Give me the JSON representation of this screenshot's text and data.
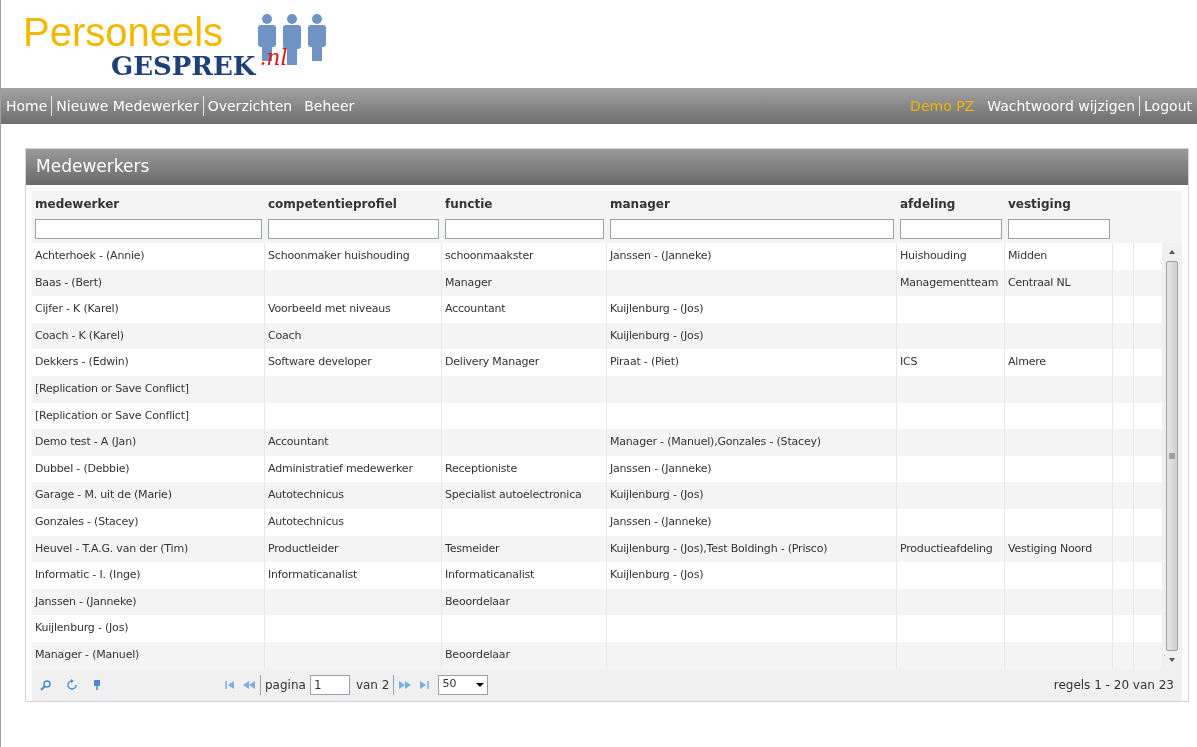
{
  "logo": {
    "line_1": "Personeels",
    "line_2": "GESPREK",
    "suffix": ".nl"
  },
  "nav": {
    "left": [
      {
        "label": "Home"
      },
      {
        "label": "Nieuwe Medewerker"
      },
      {
        "label": "Overzichten"
      },
      {
        "label": "Beheer"
      }
    ],
    "user": "Demo PZ",
    "right": [
      {
        "label": "Wachtwoord wijzigen"
      },
      {
        "label": "Logout"
      }
    ]
  },
  "panel": {
    "title": "Medewerkers"
  },
  "table": {
    "columns": [
      "medewerker",
      "competentieprofiel",
      "functie",
      "manager",
      "afdeling",
      "vestiging"
    ],
    "rows": [
      [
        "Achterhoek - (Annie)",
        "Schoonmaker huishouding",
        "schoonmaakster",
        "Janssen - (Janneke)",
        "Huishouding",
        "Midden"
      ],
      [
        "Baas - (Bert)",
        "",
        "Manager",
        "",
        "Managementteam",
        "Centraal NL"
      ],
      [
        "Cijfer - K (Karel)",
        "Voorbeeld met niveaus",
        "Accountant",
        "Kuijlenburg - (Jos)",
        "",
        ""
      ],
      [
        "Coach - K (Karel)",
        "Coach",
        "",
        "Kuijlenburg - (Jos)",
        "",
        ""
      ],
      [
        "Dekkers - (Edwin)",
        "Software developer",
        "Delivery Manager",
        "Piraat - (Piet)",
        "ICS",
        "Almere"
      ],
      [
        "[Replication or Save Conflict]",
        "",
        "",
        "",
        "",
        ""
      ],
      [
        "[Replication or Save Conflict]",
        "",
        "",
        "",
        "",
        ""
      ],
      [
        "Demo test - A (Jan)",
        "Accountant",
        "",
        "Manager - (Manuel),Gonzales - (Stacey)",
        "",
        ""
      ],
      [
        "Dubbel - (Debbie)",
        "Administratief medewerker",
        "Receptioniste",
        "Janssen - (Janneke)",
        "",
        ""
      ],
      [
        "Garage - M. uit de (Marie)",
        "Autotechnicus",
        "Specialist autoelectronica",
        "Kuijlenburg - (Jos)",
        "",
        ""
      ],
      [
        "Gonzales - (Stacey)",
        "Autotechnicus",
        "",
        "Janssen - (Janneke)",
        "",
        ""
      ],
      [
        "Heuvel - T.A.G. van der (Tim)",
        "Productleider",
        "Tesmeider",
        "Kuijlenburg - (Jos),Test Boldingh - (Prisco)",
        "Productieafdeling",
        "Vestiging Noord"
      ],
      [
        "Informatic - I. (Inge)",
        "Informaticanalist",
        "Informaticanalist",
        "Kuijlenburg - (Jos)",
        "",
        ""
      ],
      [
        "Janssen - (Janneke)",
        "",
        "Beoordelaar",
        "",
        "",
        ""
      ],
      [
        "Kuijlenburg - (Jos)",
        "",
        "",
        "",
        "",
        ""
      ],
      [
        "Manager - (Manuel)",
        "",
        "Beoordelaar",
        "",
        "",
        ""
      ]
    ]
  },
  "pager": {
    "page_label": "pagina",
    "page": "1",
    "of_label": "van 2",
    "page_size": "50",
    "summary": "regels 1 - 20 van 23"
  }
}
